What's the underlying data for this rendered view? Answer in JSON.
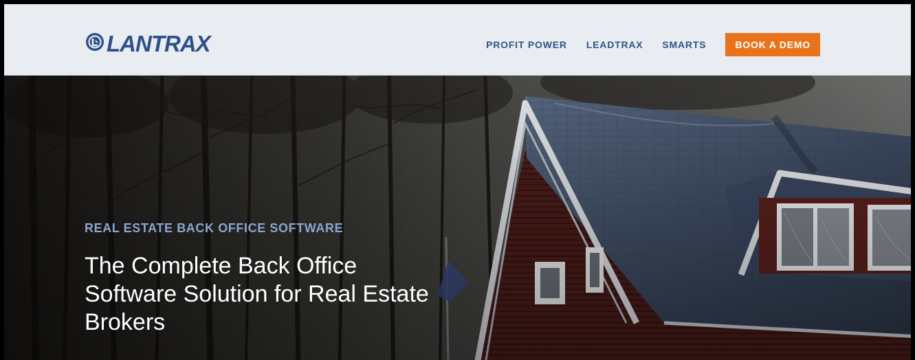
{
  "brand": {
    "name": "LANTRAX",
    "logo_prefix": "LAN",
    "logo_suffix": "TRAX",
    "colors": {
      "header_bg": "#e9edf2",
      "brand_blue": "#2f5088",
      "nav_blue": "#2d5486",
      "cta_orange": "#e8731a",
      "eyebrow_blue": "#8aa6cf"
    }
  },
  "nav": {
    "items": [
      {
        "label": "PROFIT POWER"
      },
      {
        "label": "LEADTRAX"
      },
      {
        "label": "SMARTS"
      }
    ],
    "cta_label": "BOOK A DEMO"
  },
  "hero": {
    "eyebrow": "REAL ESTATE BACK OFFICE SOFTWARE",
    "headline": "The Complete Back Office Software Solution for Real Estate Brokers",
    "background_image": "house-with-slate-roof-in-misty-forest"
  }
}
